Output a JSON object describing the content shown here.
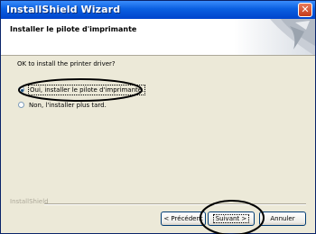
{
  "window": {
    "title": "InstallShield Wizard",
    "close_glyph": "✕",
    "header_title": "Installer le  pilote d'imprimante",
    "question": "OK to install the printer driver?"
  },
  "options": [
    {
      "label": "Oui, installer le pilote d'imprimante.",
      "selected": true
    },
    {
      "label": "Non, l'installer plus tard.",
      "selected": false
    }
  ],
  "footer": {
    "group_label": "InstallShield",
    "back_label": "< Précédent",
    "next_label": "Suivant >",
    "cancel_label": "Annuler"
  },
  "colors": {
    "titlebar": "#0a5fe0",
    "annotation": "#000000"
  }
}
